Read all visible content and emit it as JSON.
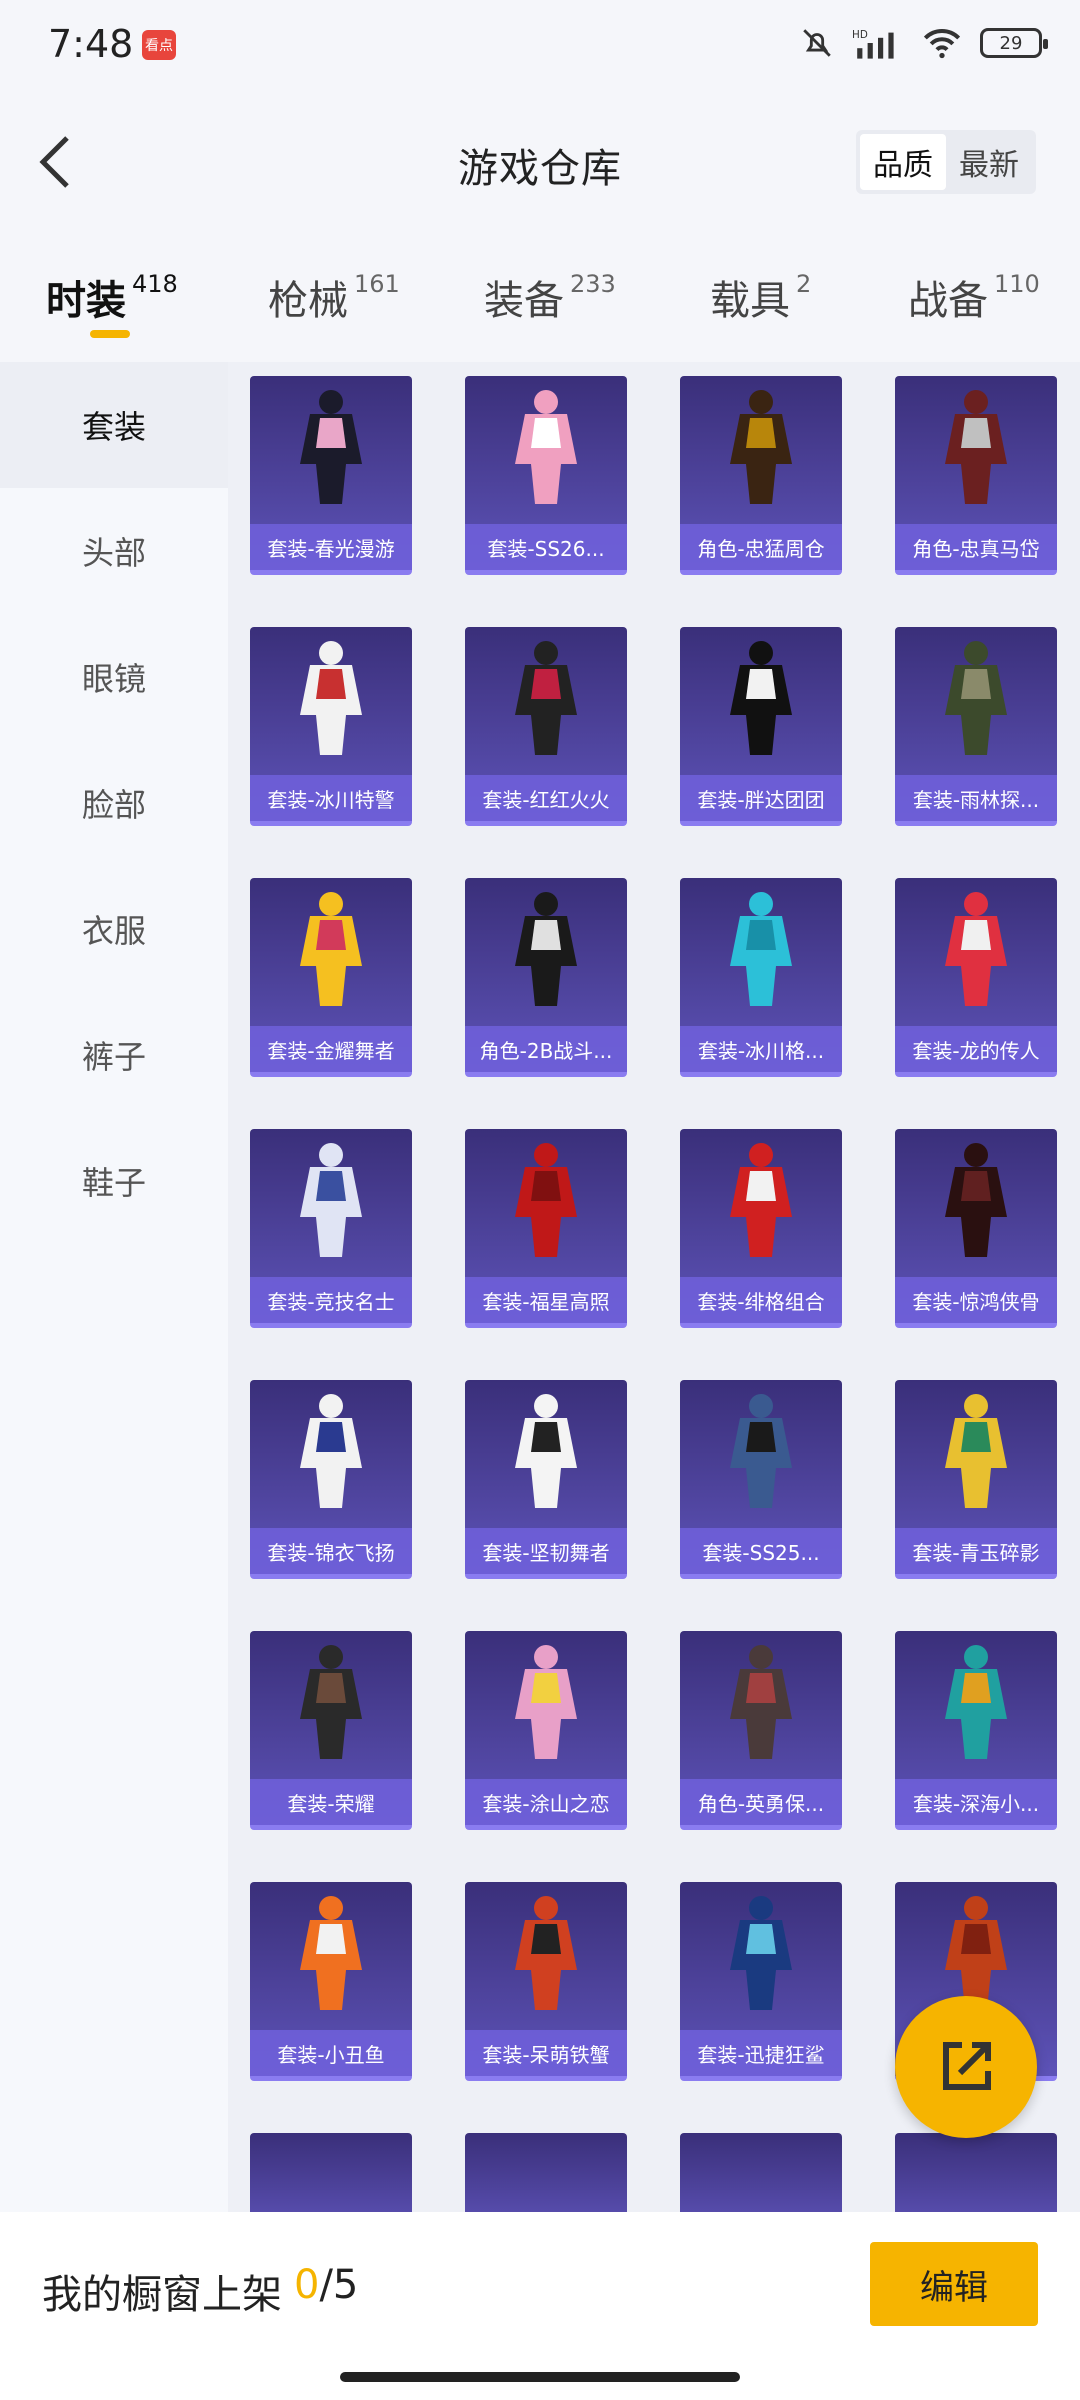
{
  "status": {
    "time": "7:48",
    "app_icon_text": "看点",
    "battery": "29",
    "icons": [
      "mute-bell-icon",
      "hd-signal-icon",
      "wifi-icon",
      "battery-icon"
    ]
  },
  "header": {
    "title": "游戏仓库",
    "sort_options": [
      "品质",
      "最新"
    ],
    "active_sort": "品质"
  },
  "tabs": [
    {
      "label": "时装",
      "count": "418",
      "active": true
    },
    {
      "label": "枪械",
      "count": "161",
      "active": false
    },
    {
      "label": "装备",
      "count": "233",
      "active": false
    },
    {
      "label": "载具",
      "count": "2",
      "active": false
    },
    {
      "label": "战备",
      "count": "110",
      "active": false
    }
  ],
  "sidebar": {
    "items": [
      "套装",
      "头部",
      "眼镜",
      "脸部",
      "衣服",
      "裤子",
      "鞋子"
    ],
    "active": "套装"
  },
  "items": [
    "套装-春光漫游",
    "套装-SS26...",
    "角色-忠猛周仓",
    "角色-忠真马岱",
    "套装-冰川特警",
    "套装-红红火火",
    "套装-胖达团团",
    "套装-雨林探...",
    "套装-金耀舞者",
    "角色-2B战斗...",
    "套装-冰川格...",
    "套装-龙的传人",
    "套装-竞技名士",
    "套装-福星高照",
    "套装-绯格组合",
    "套装-惊鸿侠骨",
    "套装-锦衣飞扬",
    "套装-坚韧舞者",
    "套装-SS25...",
    "套装-青玉碎影",
    "套装-荣耀",
    "套装-涂山之恋",
    "角色-英勇保...",
    "套装-深海小...",
    "套装-小丑鱼",
    "套装-呆萌铁蟹",
    "套装-迅捷狂鲨",
    ""
  ],
  "bottom": {
    "showcase_label": "我的橱窗上架",
    "showcase_count": "0",
    "showcase_total": "/5",
    "edit_label": "编辑"
  },
  "colors": {
    "accent": "#f6b400",
    "card_top": "#3a2f7a",
    "card_bottom": "#5d53b8",
    "card_label": "#7060dc"
  }
}
